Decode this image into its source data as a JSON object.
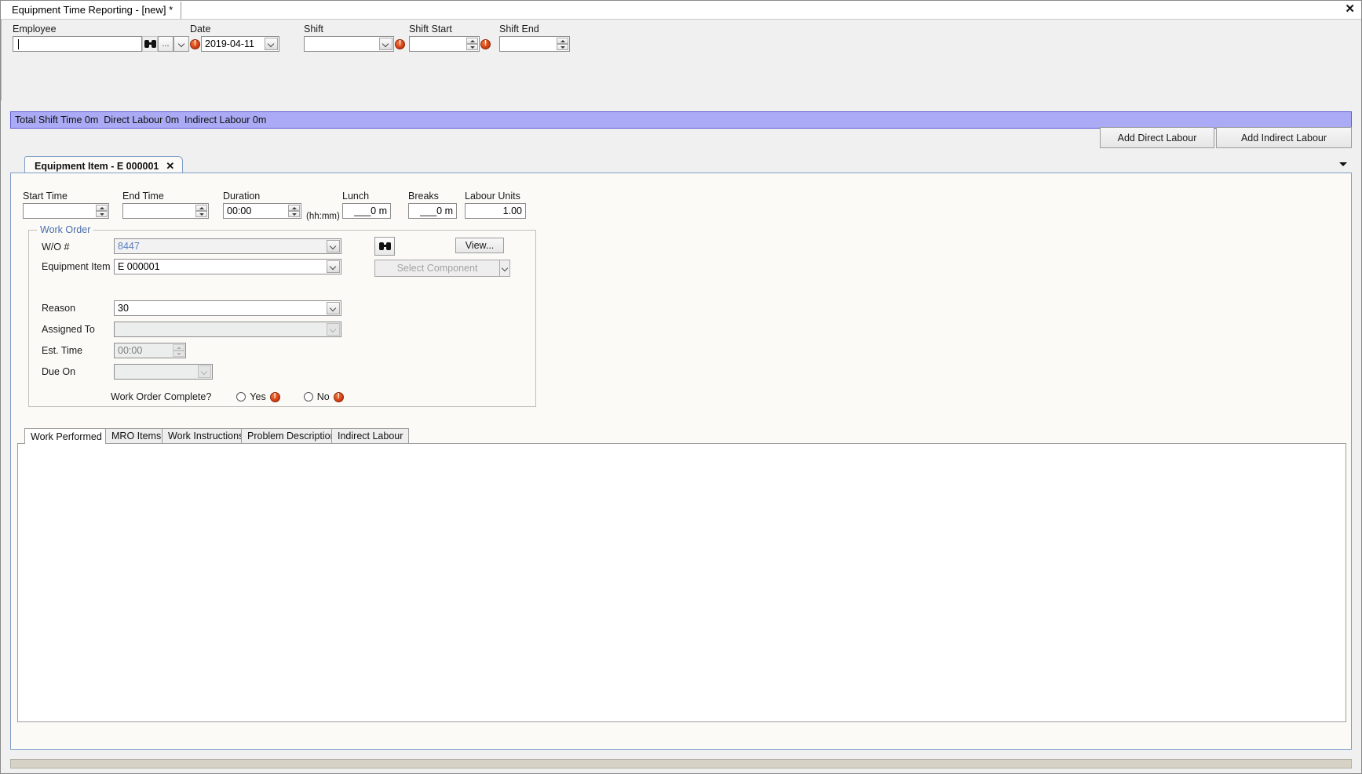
{
  "window": {
    "tab_title": "Equipment Time Reporting - [new] *",
    "close_label": "✕"
  },
  "header": {
    "employee": {
      "label": "Employee",
      "value": "",
      "find_icon": "binoculars-icon",
      "ellipsis_label": "...",
      "dropdown_icon": "chevron-down-icon"
    },
    "date": {
      "label": "Date",
      "value": "2019-04-11",
      "error": "!"
    },
    "shift": {
      "label": "Shift",
      "value": "",
      "error": "!"
    },
    "shift_start": {
      "label": "Shift Start",
      "value": "",
      "error": "!"
    },
    "shift_end": {
      "label": "Shift End",
      "value": ""
    }
  },
  "summary": {
    "text": "Total Shift Time 0m  Direct Labour 0m  Indirect Labour 0m"
  },
  "actions": {
    "add_direct_labour": "Add Direct Labour",
    "add_indirect_labour": "Add Indirect Labour"
  },
  "detail_tab": {
    "label": "Equipment Item - E 000001",
    "close": "✕"
  },
  "times": {
    "start_time": {
      "label": "Start Time",
      "value": ""
    },
    "end_time": {
      "label": "End Time",
      "value": ""
    },
    "duration": {
      "label": "Duration",
      "value": "00:00",
      "units": "(hh:mm)"
    },
    "lunch": {
      "label": "Lunch",
      "value": "___0 m"
    },
    "breaks": {
      "label": "Breaks",
      "value": "___0 m"
    },
    "labour_units": {
      "label": "Labour Units",
      "value": "1.00"
    }
  },
  "work_order": {
    "group_title": "Work Order",
    "wo_number": {
      "label": "W/O #",
      "value": "8447"
    },
    "find_button_icon": "binoculars-icon",
    "view_button": "View...",
    "equipment_item": {
      "label": "Equipment Item",
      "value": "E 000001"
    },
    "select_component": {
      "label": "Select Component"
    },
    "reason": {
      "label": "Reason",
      "value": "30"
    },
    "assigned_to": {
      "label": "Assigned To",
      "value": ""
    },
    "est_time": {
      "label": "Est. Time",
      "value": "00:00"
    },
    "due_on": {
      "label": "Due On",
      "value": ""
    },
    "complete": {
      "label": "Work Order Complete?",
      "yes_label": "Yes",
      "no_label": "No",
      "yes_error": "!",
      "no_error": "!"
    }
  },
  "bottom_tabs": [
    {
      "label": "Work Performed",
      "active": true
    },
    {
      "label": "MRO Items",
      "active": false
    },
    {
      "label": "Work Instructions",
      "active": false
    },
    {
      "label": "Problem Description",
      "active": false
    },
    {
      "label": "Indirect Labour",
      "active": false
    }
  ],
  "colors": {
    "summary_bar": "#aaaaf5",
    "error_badge": "#d64216",
    "tab_border": "#7f9dc6",
    "panel_bg": "#fbfaf7"
  }
}
